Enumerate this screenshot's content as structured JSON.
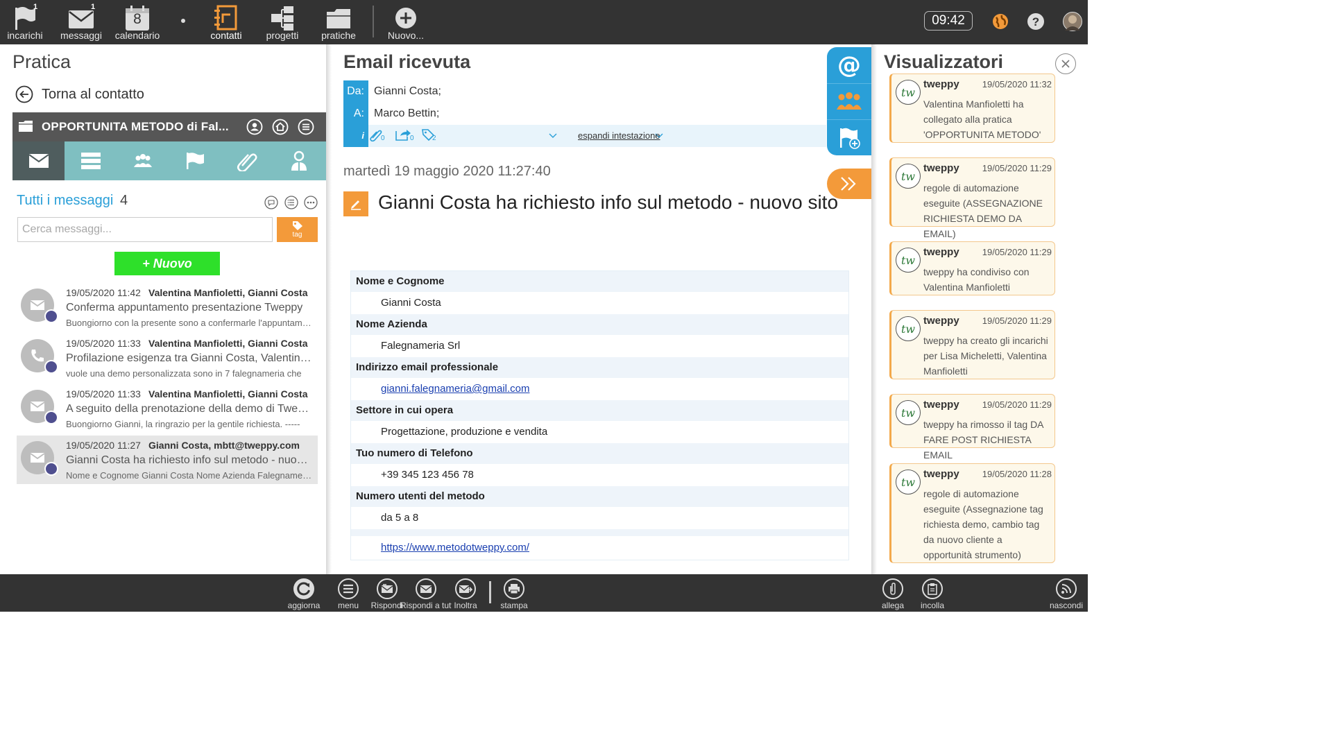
{
  "topbar": {
    "items": [
      {
        "label": "incarichi",
        "icon": "flag-icon",
        "badge": "1"
      },
      {
        "label": "messaggi",
        "icon": "envelope-icon",
        "badge": "1"
      },
      {
        "label": "calendario",
        "icon": "calendar-icon",
        "day": "8"
      },
      {
        "label": "contatti",
        "icon": "contacts-icon"
      },
      {
        "label": "progetti",
        "icon": "projects-icon"
      },
      {
        "label": "pratiche",
        "icon": "folder-icon"
      },
      {
        "label": "Nuovo...",
        "icon": "plus-circle-icon"
      }
    ],
    "clock": "09:42",
    "accent": "#f39a3a"
  },
  "left": {
    "title": "Pratica",
    "back_label": "Torna al contatto",
    "opportunity_title": "OPPORTUNITA METODO di Fal...",
    "tabs": [
      "envelope-icon",
      "list-icon",
      "people-icon",
      "flag-icon",
      "paperclip-icon",
      "person-icon"
    ],
    "messages_title": "Tutti i messaggi",
    "messages_count": "4",
    "search_placeholder": "Cerca messaggi...",
    "tag_label": "tag",
    "new_label": "+ Nuovo",
    "messages": [
      {
        "date": "19/05/2020 11:42",
        "from": "Valentina Manfioletti, Gianni Costa",
        "subject": "Conferma appuntamento presentazione Tweppy",
        "preview": "Buongiorno con la presente sono a confermarle l'appuntamento",
        "icon": "envelope-icon"
      },
      {
        "date": "19/05/2020 11:33",
        "from": "Valentina Manfioletti, Gianni Costa",
        "subject": "Profilazione esigenza tra Gianni Costa, Valentina Manfioletti",
        "preview": "vuole una demo personalizzata sono in 7 falegnameria che",
        "icon": "phone-icon"
      },
      {
        "date": "19/05/2020 11:33",
        "from": "Valentina Manfioletti, Gianni Costa",
        "subject": "A seguito della prenotazione della demo di Tweppy",
        "preview": "Buongiorno Gianni, la ringrazio per la gentile richiesta. -----",
        "icon": "envelope-icon"
      },
      {
        "date": "19/05/2020 11:27",
        "from": "Gianni Costa, mbtt@tweppy.com",
        "subject": "Gianni Costa ha richiesto info sul metodo - nuovo sito",
        "preview": "Nome e Cognome Gianni Costa Nome Azienda Falegnameria Srl",
        "icon": "envelope-icon"
      }
    ]
  },
  "email": {
    "title": "Email ricevuta",
    "from_label": "Da:",
    "from": "Gianni Costa;",
    "to_label": "A:",
    "to": "Marco Bettin;",
    "info_label": "i",
    "attach_count": "0",
    "forward_count": "0",
    "tag_count": "2",
    "expand_label": "espandi intestazione",
    "date": "martedì 19 maggio 2020 11:27:40",
    "subject": "Gianni Costa ha richiesto info sul metodo - nuovo sito",
    "fields": [
      {
        "label": "Nome e Cognome",
        "value": "Gianni Costa"
      },
      {
        "label": "Nome Azienda",
        "value": "Falegnameria Srl"
      },
      {
        "label": "Indirizzo email professionale",
        "value": "gianni.falegnameria@gmail.com",
        "link": true
      },
      {
        "label": "Settore in cui opera",
        "value": "Progettazione, produzione e vendita"
      },
      {
        "label": "Tuo numero di Telefono",
        "value": "+39 345 123 456 78"
      },
      {
        "label": "Numero utenti del metodo",
        "value": "da 5 a 8"
      }
    ],
    "site_link": "https://www.metodotweppy.com/"
  },
  "viewers": {
    "title": "Visualizzatori",
    "cards": [
      {
        "user": "tweppy",
        "time": "19/05/2020 11:32",
        "text": "Valentina Manfioletti ha collegato alla pratica 'OPPORTUNITA METODO'"
      },
      {
        "user": "tweppy",
        "time": "19/05/2020 11:29",
        "text": "regole di automazione eseguite (ASSEGNAZIONE RICHIESTA DEMO DA EMAIL)"
      },
      {
        "user": "tweppy",
        "time": "19/05/2020 11:29",
        "text": "tweppy ha condiviso con Valentina Manfioletti"
      },
      {
        "user": "tweppy",
        "time": "19/05/2020 11:29",
        "text": "tweppy ha creato gli incarichi per Lisa Micheletti, Valentina Manfioletti"
      },
      {
        "user": "tweppy",
        "time": "19/05/2020 11:29",
        "text": "tweppy ha rimosso il tag DA FARE POST RICHIESTA EMAIL"
      },
      {
        "user": "tweppy",
        "time": "19/05/2020 11:28",
        "text": "regole di automazione eseguite (Assegnazione tag richiesta demo, cambio tag da nuovo cliente a opportunità strumento)"
      }
    ]
  },
  "bottombar": {
    "items": [
      {
        "label": "aggiorna",
        "icon": "refresh-icon"
      },
      {
        "label": "menu",
        "icon": "menu-icon"
      },
      {
        "label": "Rispondi",
        "icon": "reply-icon"
      },
      {
        "label": "Rispondi a tutti",
        "icon": "reply-all-icon"
      },
      {
        "label": "Inoltra",
        "icon": "forward-icon"
      },
      {
        "label": "stampa",
        "icon": "print-icon"
      },
      {
        "label": "allega",
        "icon": "paperclip-icon"
      },
      {
        "label": "incolla",
        "icon": "paste-icon"
      },
      {
        "label": "nascondi",
        "icon": "rss-icon"
      }
    ]
  }
}
